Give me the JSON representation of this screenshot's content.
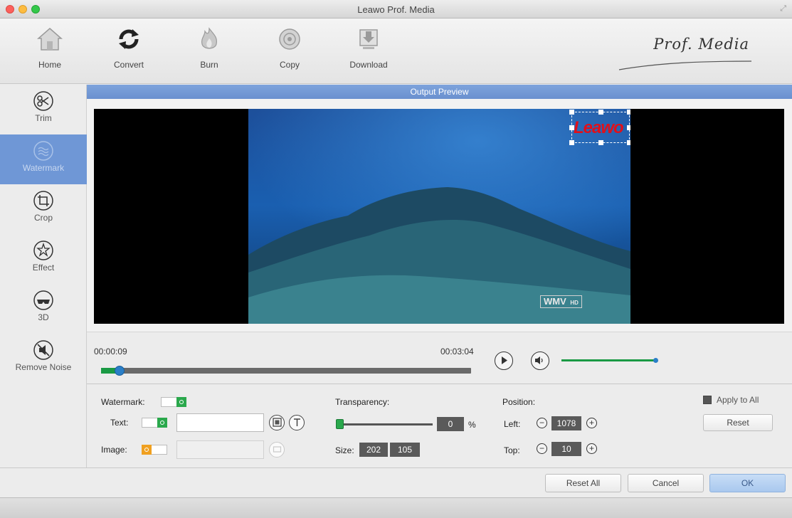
{
  "window": {
    "title": "Leawo Prof. Media"
  },
  "toolbar": {
    "items": [
      {
        "label": "Home",
        "icon": "home-icon"
      },
      {
        "label": "Convert",
        "icon": "convert-icon"
      },
      {
        "label": "Burn",
        "icon": "burn-icon"
      },
      {
        "label": "Copy",
        "icon": "copy-icon"
      },
      {
        "label": "Download",
        "icon": "download-icon"
      }
    ],
    "brand": "Prof. Media"
  },
  "sidebar": {
    "items": [
      {
        "label": "Trim",
        "icon": "scissors-icon"
      },
      {
        "label": "Watermark",
        "icon": "watermark-icon",
        "active": true
      },
      {
        "label": "Crop",
        "icon": "crop-icon"
      },
      {
        "label": "Effect",
        "icon": "effect-icon"
      },
      {
        "label": "3D",
        "icon": "3d-glasses-icon"
      },
      {
        "label": "Remove Noise",
        "icon": "remove-noise-icon"
      }
    ]
  },
  "preview": {
    "header": "Output Preview",
    "watermark_text": "Leawo",
    "video_badge": "WMV",
    "video_badge_sub": "HD"
  },
  "player": {
    "current_time": "00:00:09",
    "total_time": "00:03:04",
    "progress_fraction": 0.05,
    "volume_fraction": 1.0
  },
  "settings": {
    "watermark_label": "Watermark:",
    "watermark_on": true,
    "text_label": "Text:",
    "text_on": true,
    "text_value": "",
    "image_label": "Image:",
    "image_on": false,
    "transparency_label": "Transparency:",
    "transparency_value": "0",
    "transparency_unit": "%",
    "size_label": "Size:",
    "size_width": "202",
    "size_height": "105",
    "position_label": "Position:",
    "left_label": "Left:",
    "left_value": "1078",
    "top_label": "Top:",
    "top_value": "10",
    "apply_to_all_label": "Apply to All",
    "apply_to_all_checked": true,
    "reset_label": "Reset"
  },
  "footer": {
    "reset_all_label": "Reset All",
    "cancel_label": "Cancel",
    "ok_label": "OK"
  },
  "colors": {
    "accent_blue": "#6f97d6",
    "toggle_green": "#2aa84c",
    "toggle_orange": "#f0a020",
    "watermark_red": "#e0101a"
  }
}
